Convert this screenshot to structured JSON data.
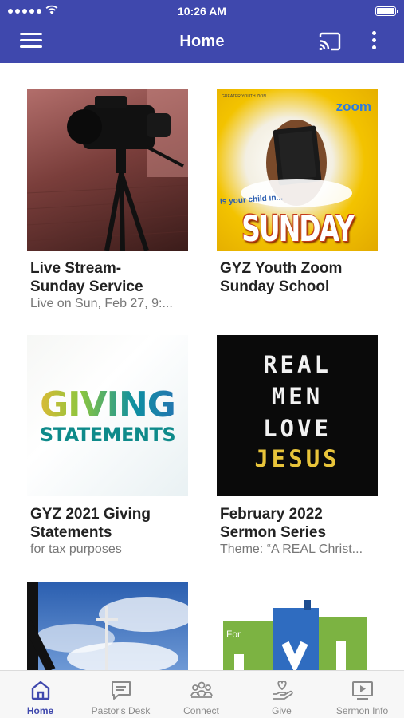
{
  "status_bar": {
    "time": "10:26 AM"
  },
  "header": {
    "title": "Home",
    "icons": [
      "menu-icon",
      "cast-icon",
      "more-vert-icon"
    ]
  },
  "cards": [
    {
      "title_line1": "Live Stream-",
      "title_line2": "Sunday Service",
      "subtitle": "Live on Sun, Feb 27, 9:..."
    },
    {
      "title_line1": "GYZ Youth Zoom",
      "title_line2": "Sunday School",
      "subtitle": "",
      "image_text": {
        "logo": "GREATER YOUTH ZION",
        "zoom": "zoom",
        "tag": "Is your child in...",
        "headline": "SUNDAY SCHOOL?"
      }
    },
    {
      "title_line1": "GYZ 2021 Giving",
      "title_line2": "Statements",
      "subtitle": "for tax purposes",
      "image_text": {
        "line1": "GIVING",
        "line2": "STATEMENTS"
      }
    },
    {
      "title_line1": "February 2022",
      "title_line2": "Sermon Series",
      "subtitle": "Theme: “A REAL Christ...",
      "image_text": {
        "line1": "REAL",
        "line2": "MEN",
        "line3": "LOVE",
        "line4": "JESUS"
      }
    },
    {
      "title_line1": "",
      "title_line2": "",
      "subtitle": ""
    },
    {
      "title_line1": "",
      "title_line2": "",
      "subtitle": "",
      "image_text": {
        "tag": "For"
      }
    }
  ],
  "bottom_nav": [
    {
      "label": "Home",
      "icon": "home-icon",
      "active": true
    },
    {
      "label": "Pastor's Desk",
      "icon": "message-icon",
      "active": false
    },
    {
      "label": "Connect",
      "icon": "people-icon",
      "active": false
    },
    {
      "label": "Give",
      "icon": "give-hand-icon",
      "active": false
    },
    {
      "label": "Sermon Info",
      "icon": "video-play-icon",
      "active": false
    }
  ],
  "colors": {
    "primary": "#3f48ad",
    "nav_inactive": "#8a8a8a",
    "title_text": "#222222",
    "subtitle_text": "#777777"
  }
}
